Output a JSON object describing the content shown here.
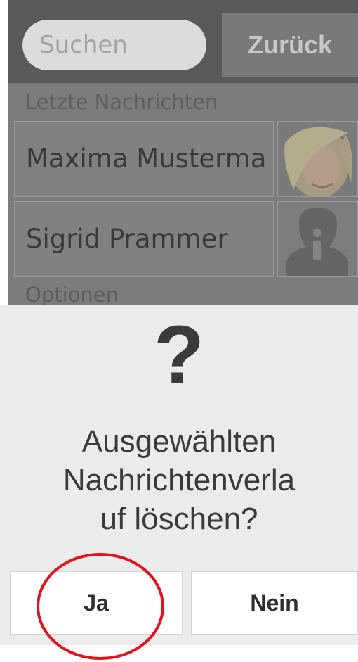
{
  "header": {
    "search_placeholder": "Suchen",
    "back_label": "Zurück"
  },
  "sections": {
    "recent_label": "Letzte Nachrichten",
    "options_label": "Optionen"
  },
  "messages": [
    {
      "name": "Maxima Musterma",
      "avatar": "photo-avatar"
    },
    {
      "name": "Sigrid Prammer",
      "avatar": "placeholder-person-avatar"
    }
  ],
  "dialog": {
    "icon": "question-mark",
    "message_lines": [
      "Ausgewählten",
      "Nachrichtenverla",
      "uf löschen?"
    ],
    "yes_label": "Ja",
    "no_label": "Nein"
  },
  "annotation": {
    "color": "#e0141e",
    "target": "yes-button"
  }
}
